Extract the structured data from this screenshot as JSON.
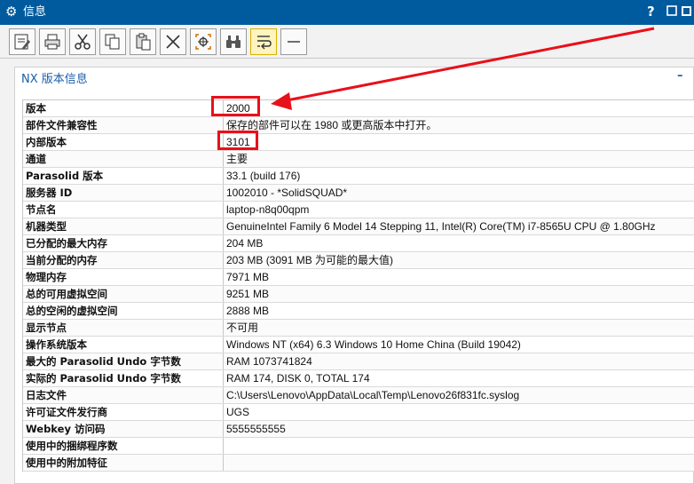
{
  "window": {
    "title": "信息",
    "help": "?",
    "title_icon": "gear-icon"
  },
  "toolbar": {
    "buttons": [
      {
        "name": "save-icon"
      },
      {
        "name": "print-icon"
      },
      {
        "name": "cut-icon"
      },
      {
        "name": "copy-icon"
      },
      {
        "name": "paste-icon"
      },
      {
        "name": "delete-icon"
      },
      {
        "name": "find-icon"
      },
      {
        "name": "binoculars-icon"
      },
      {
        "name": "wrap-icon",
        "active": true
      },
      {
        "name": "minus-icon"
      }
    ]
  },
  "panel": {
    "title": "NX 版本信息",
    "collapse": "–"
  },
  "rows": [
    {
      "label": "版本",
      "value": "2000"
    },
    {
      "label": "部件文件兼容性",
      "value": "保存的部件可以在 1980 或更高版本中打开。"
    },
    {
      "label": "内部版本",
      "value": "3101"
    },
    {
      "label": "通道",
      "value": "主要"
    },
    {
      "label": "Parasolid 版本",
      "value": "33.1 (build 176)"
    },
    {
      "label": "服务器 ID",
      "value": "1002010 - *SolidSQUAD*"
    },
    {
      "label": "节点名",
      "value": "laptop-n8q00qpm"
    },
    {
      "label": "机器类型",
      "value": "GenuineIntel Family 6 Model 14 Stepping 11, Intel(R) Core(TM) i7-8565U CPU @ 1.80GHz"
    },
    {
      "label": "已分配的最大内存",
      "value": "204 MB"
    },
    {
      "label": "当前分配的内存",
      "value": "203 MB (3091 MB 为可能的最大值)"
    },
    {
      "label": "物理内存",
      "value": "7971 MB"
    },
    {
      "label": "总的可用虚拟空间",
      "value": "9251 MB"
    },
    {
      "label": "总的空闲的虚拟空间",
      "value": "2888 MB"
    },
    {
      "label": "显示节点",
      "value": "不可用"
    },
    {
      "label": "操作系统版本",
      "value": "Windows NT (x64) 6.3 Windows 10 Home China (Build 19042)"
    },
    {
      "label": "最大的 Parasolid Undo 字节数",
      "value": "RAM 1073741824"
    },
    {
      "label": "实际的 Parasolid Undo 字节数",
      "value": "RAM 174, DISK 0, TOTAL 174"
    },
    {
      "label": "日志文件",
      "value": "C:\\Users\\Lenovo\\AppData\\Local\\Temp\\Lenovo26f831fc.syslog"
    },
    {
      "label": "许可证文件发行商",
      "value": "UGS"
    },
    {
      "label": "Webkey 访问码",
      "value": "5555555555"
    },
    {
      "label": "使用中的捆绑程序数",
      "value": ""
    },
    {
      "label": "使用中的附加特征",
      "value": ""
    }
  ],
  "annotation": {
    "color": "#e8101a"
  }
}
